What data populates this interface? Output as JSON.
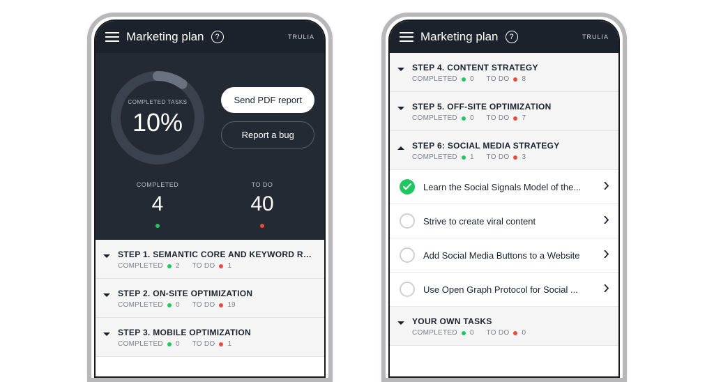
{
  "header": {
    "title": "Marketing plan",
    "brand": "TRULIA"
  },
  "dashboard": {
    "progress_label": "COMPLETED TASKS",
    "progress_percent": 10,
    "progress_text": "10%",
    "btn_pdf": "Send PDF report",
    "btn_bug": "Report a bug",
    "completed_label": "COMPLETED",
    "completed_num": "4",
    "todo_label": "TO DO",
    "todo_num": "40"
  },
  "labels": {
    "completed": "COMPLETED",
    "todo": "TO DO"
  },
  "left_steps": [
    {
      "title": "STEP 1. SEMANTIC CORE AND KEYWORD RE...",
      "completed": "2",
      "todo": "1",
      "expanded": false
    },
    {
      "title": "STEP 2. ON-SITE OPTIMIZATION",
      "completed": "0",
      "todo": "19",
      "expanded": false
    },
    {
      "title": "STEP 3. MOBILE OPTIMIZATION",
      "completed": "0",
      "todo": "1",
      "expanded": false
    }
  ],
  "right_steps_top": [
    {
      "title": "STEP 4. CONTENT STRATEGY",
      "completed": "0",
      "todo": "8",
      "expanded": false
    },
    {
      "title": "STEP 5. OFF-SITE OPTIMIZATION",
      "completed": "0",
      "todo": "7",
      "expanded": false
    },
    {
      "title": "STEP 6: SOCIAL MEDIA STRATEGY",
      "completed": "1",
      "todo": "3",
      "expanded": true
    }
  ],
  "right_tasks": [
    {
      "title": "Learn the Social Signals Model of the...",
      "done": true
    },
    {
      "title": "Strive to create viral content",
      "done": false
    },
    {
      "title": "Add Social Media Buttons to a Website",
      "done": false
    },
    {
      "title": "Use Open Graph Protocol for Social ...",
      "done": false
    }
  ],
  "own_step": {
    "title": "YOUR OWN TASKS",
    "completed": "0",
    "todo": "0",
    "expanded": false
  },
  "colors": {
    "green": "#1ec85e",
    "red": "#f04b3e",
    "dark": "#232a34"
  }
}
